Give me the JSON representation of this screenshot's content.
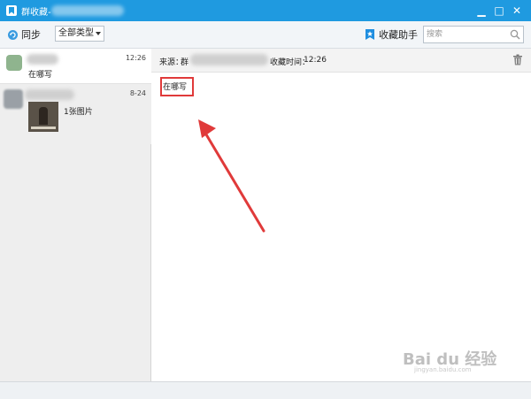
{
  "window": {
    "title": "群收藏-",
    "controls": {
      "minimize": "▁",
      "maximize": "□",
      "close": "✕"
    }
  },
  "toolbar": {
    "sync_label": "同步",
    "type_select": {
      "value": "全部类型"
    },
    "assistant_label": "收藏助手",
    "search_placeholder": "搜索"
  },
  "list": {
    "items": [
      {
        "time": "12:26",
        "text": "在哪写"
      },
      {
        "time": "8-24",
        "attachment_label": "1张图片"
      }
    ]
  },
  "detail": {
    "source_label": "来源：",
    "source_name": "群",
    "collected_time_label": "收藏时间：",
    "collected_time": "12:26",
    "message": "在哪写"
  },
  "watermark": {
    "brand": "Bai du 经验",
    "url": "jingyan.baidu.com"
  },
  "colors": {
    "titlebar": "#1f9ae0",
    "highlight": "#e03a3a",
    "arrow": "#e03a3a"
  },
  "icons": [
    "bookmark-icon",
    "sync-icon",
    "star-bookmark-icon",
    "search-icon",
    "trash-icon",
    "arrow-annotation"
  ]
}
